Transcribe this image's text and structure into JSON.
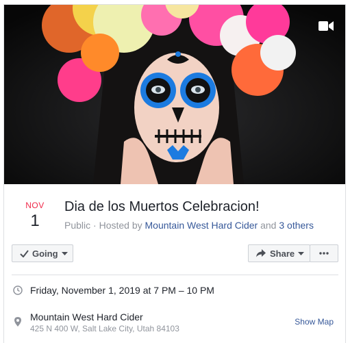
{
  "cover": {
    "media_icon": "video-camera-icon",
    "colors": {
      "background": "#0b0c0d",
      "flower_pink": "#ff4fa3",
      "flower_yellow": "#f5e56b",
      "flower_orange": "#ff7a2e",
      "face_paint_blue": "#1c7be0",
      "skin": "#f2d2c4"
    }
  },
  "event": {
    "month": "NOV",
    "day": "1",
    "title": "Dia de los Muertos Celebracion!",
    "privacy": "Public",
    "hosted_by_label": " · Hosted by ",
    "host": "Mountain West Hard Cider",
    "and_label": " and ",
    "others": "3 others"
  },
  "actions": {
    "going_label": "Going",
    "share_label": "Share",
    "more_icon": "more-dots-icon"
  },
  "details": {
    "time": "Friday, November 1, 2019 at 7 PM – 10 PM",
    "location_name": "Mountain West Hard Cider",
    "location_address": "425 N 400 W, Salt Lake City, Utah 84103",
    "show_map": "Show Map"
  },
  "colors": {
    "accent_month": "#f02849",
    "link": "#365899",
    "secondary_text": "#90949c"
  }
}
